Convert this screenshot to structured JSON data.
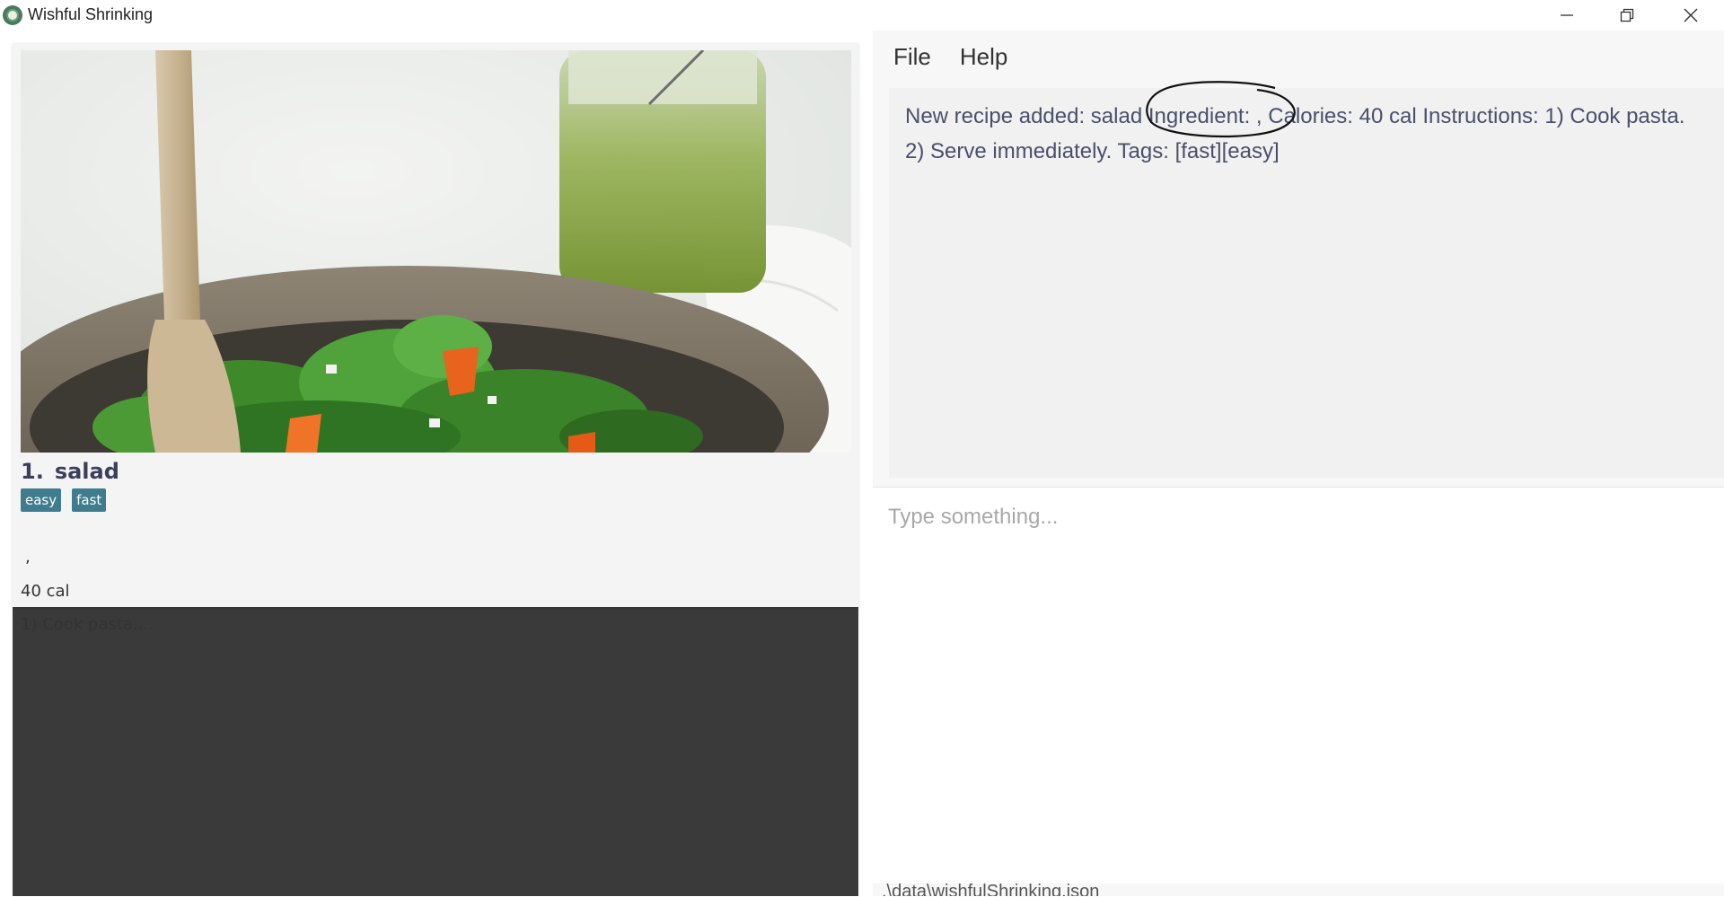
{
  "window": {
    "title": "Wishful Shrinking",
    "icon": "app-logo-icon",
    "controls": [
      "minimize-icon",
      "restore-icon",
      "close-icon"
    ]
  },
  "recipe_list": {
    "items": [
      {
        "index": "1.",
        "name": "salad",
        "tags": [
          "easy",
          "fast"
        ],
        "ingredients": ",",
        "calories": "40 cal",
        "instructions_preview": "1) Cook pasta...."
      }
    ]
  },
  "menu": {
    "file_label": "File",
    "help_label": "Help"
  },
  "result_display": {
    "message": "New recipe added: salad Ingredient:  ,  Calories: 40 cal Instructions: 1) Cook pasta.  2) Serve immediately. Tags: [fast][easy]"
  },
  "command_box": {
    "value": "",
    "placeholder": "Type something..."
  },
  "status_bar": {
    "file_path": ".\\data\\wishfulShrinking.json"
  },
  "colors": {
    "tag_bg": "#3f7c8e",
    "list_bg": "#3a3a3a",
    "card_bg": "#f4f4f4",
    "result_text": "#4a4f6a"
  }
}
